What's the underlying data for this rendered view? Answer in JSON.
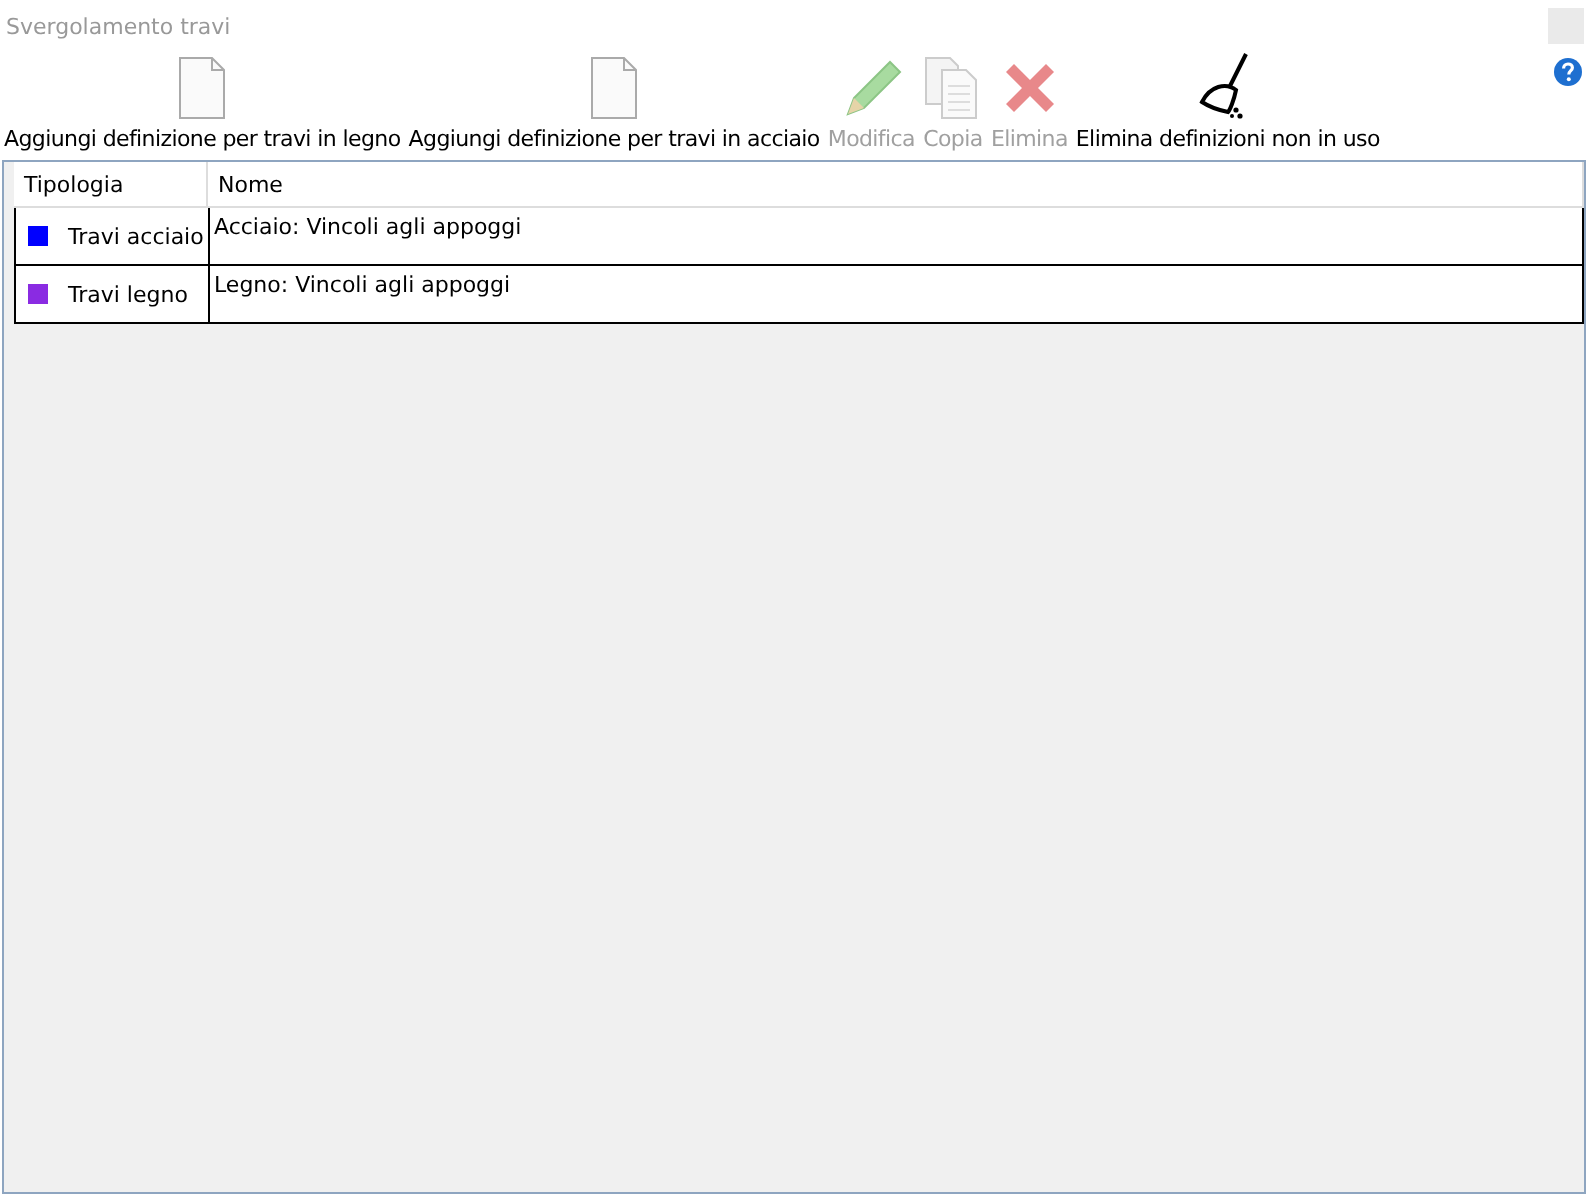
{
  "window": {
    "title": "Svergolamento travi"
  },
  "toolbar": [
    {
      "label": "Aggiungi definizione per travi in legno",
      "kind": "new",
      "disabled": false
    },
    {
      "label": "Aggiungi definizione per travi in acciaio",
      "kind": "new",
      "disabled": false
    },
    {
      "label": "Modifica",
      "kind": "edit",
      "disabled": true
    },
    {
      "label": "Copia",
      "kind": "copy",
      "disabled": true
    },
    {
      "label": "Elimina",
      "kind": "delete",
      "disabled": true
    },
    {
      "label": "Elimina definizioni non in uso",
      "kind": "clean",
      "disabled": false
    }
  ],
  "table": {
    "columns": [
      "Tipologia",
      "Nome"
    ],
    "rows": [
      {
        "type": "Travi acciaio",
        "color": "#0000ff",
        "name": "Acciaio: Vincoli agli appoggi"
      },
      {
        "type": "Travi legno",
        "color": "#8a2be2",
        "name": "Legno: Vincoli agli appoggi"
      }
    ]
  }
}
